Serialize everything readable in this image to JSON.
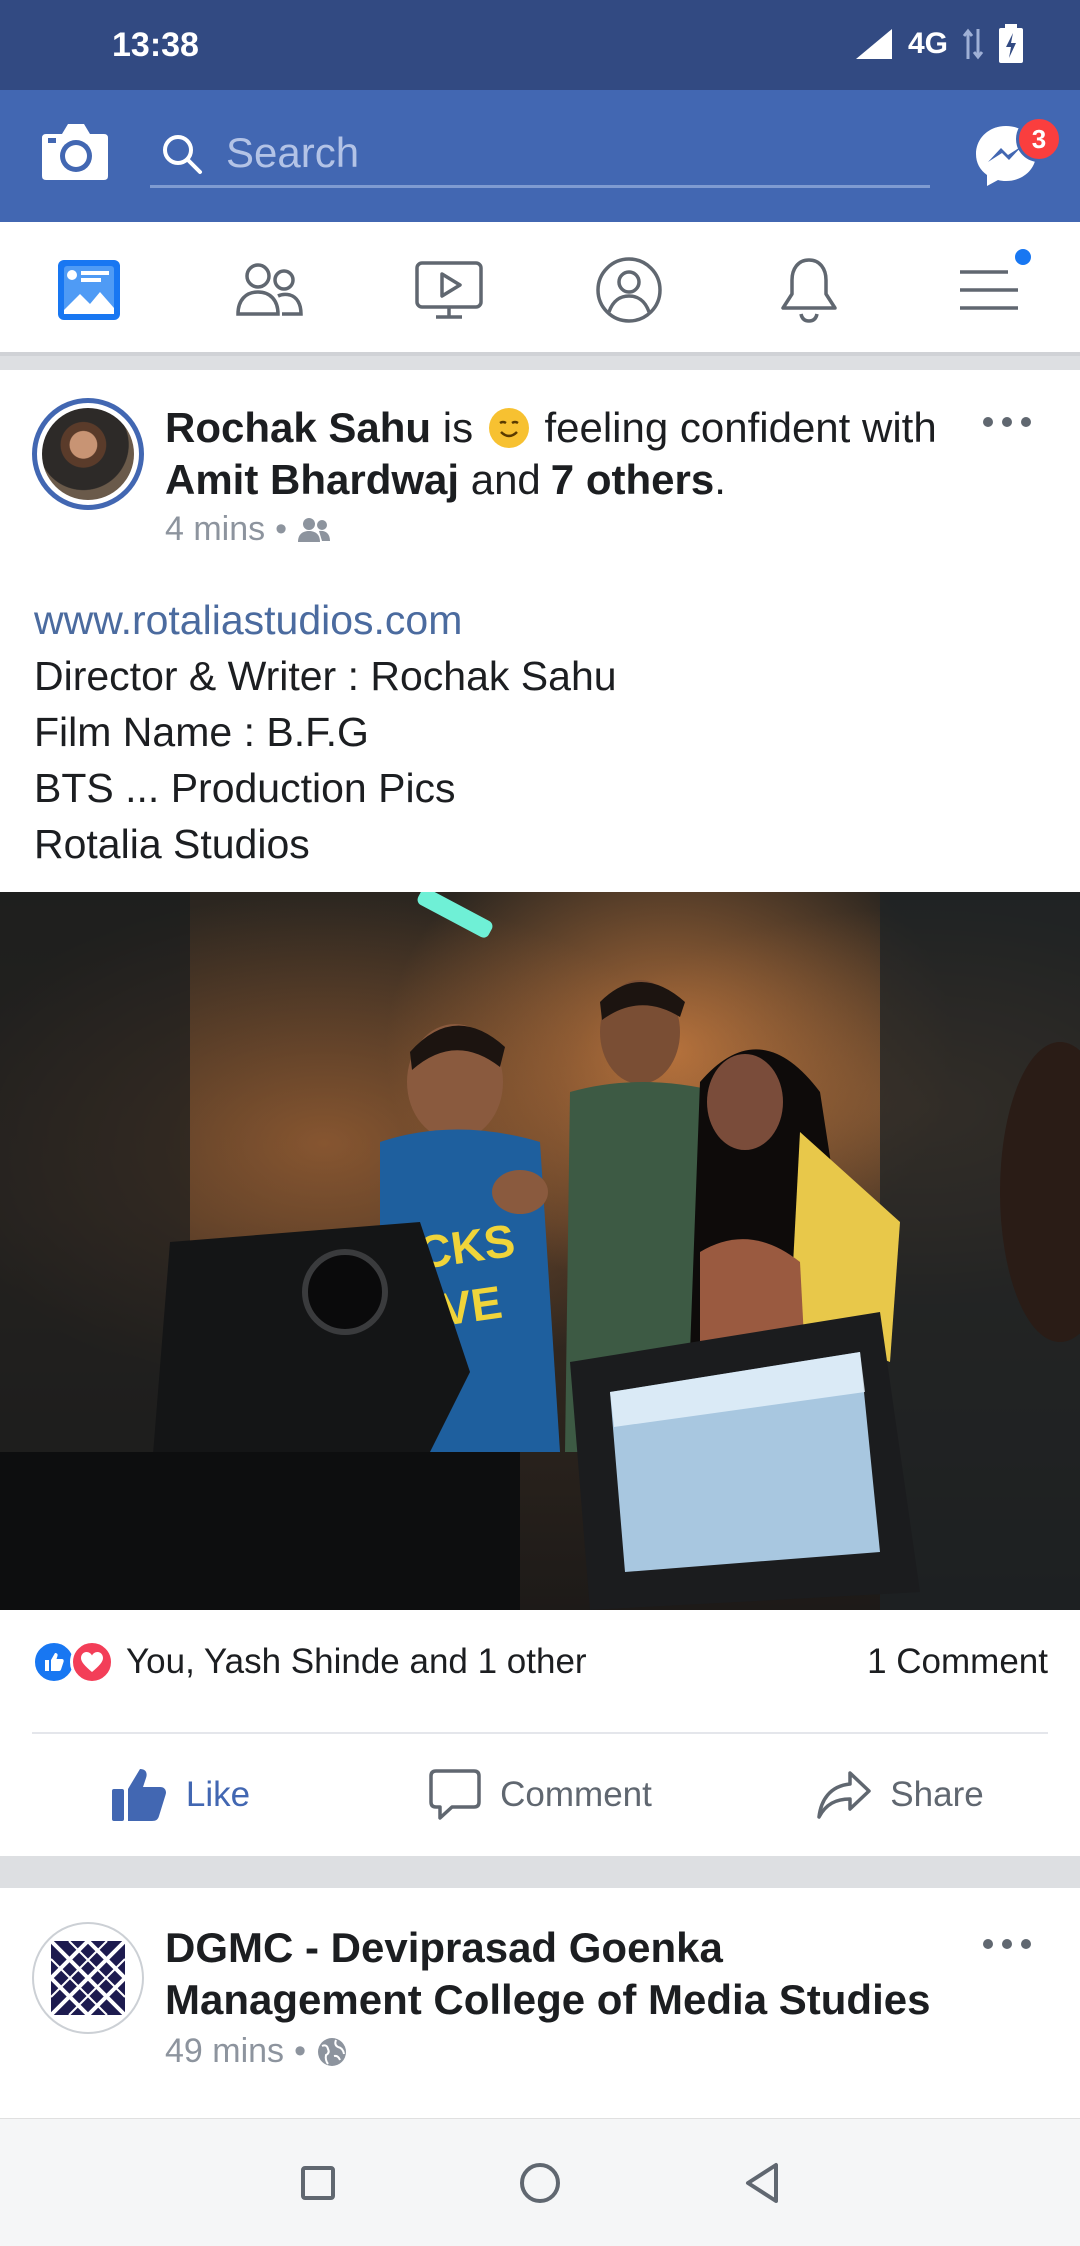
{
  "status_bar": {
    "time": "13:38",
    "network": "4G"
  },
  "header": {
    "search": {
      "placeholder": "Search"
    },
    "messenger_badge": "3"
  },
  "nav_tabs": [
    {
      "name": "news-feed",
      "icon": "news-feed-icon",
      "active": true
    },
    {
      "name": "friends",
      "icon": "friends-icon"
    },
    {
      "name": "watch",
      "icon": "watch-icon"
    },
    {
      "name": "profile",
      "icon": "profile-icon"
    },
    {
      "name": "notifications",
      "icon": "bell-icon"
    },
    {
      "name": "menu",
      "icon": "menu-icon",
      "has_dot": true
    }
  ],
  "post1": {
    "author": "Rochak Sahu",
    "is": "is",
    "feeling": "feeling confident",
    "with_word": "with",
    "tagged": "Amit Bhardwaj",
    "and_word": "and",
    "others": "7 others",
    "period": ".",
    "time": "4 mins",
    "separator": "•",
    "privacy_icon": "friends-privacy-icon",
    "body": {
      "link": "www.rotaliastudios.com",
      "lines": [
        "Director & Writer : Rochak Sahu",
        "Film Name : B.F.G",
        "BTS ... Production Pics",
        "Rotalia Studios"
      ]
    },
    "reactions_text": "You, Yash Shinde and 1 other",
    "comments_text": "1 Comment",
    "actions": {
      "like": "Like",
      "comment": "Comment",
      "share": "Share"
    }
  },
  "post2": {
    "title": "DGMC - Deviprasad Goenka Management College of Media Studies",
    "time": "49 mins",
    "separator": "•",
    "privacy_icon": "globe-icon"
  },
  "colors": {
    "brand_blue": "#4267b2",
    "status_bar": "#324a82",
    "badge_red": "#fa3e3e",
    "meta_gray": "#8d949e"
  }
}
